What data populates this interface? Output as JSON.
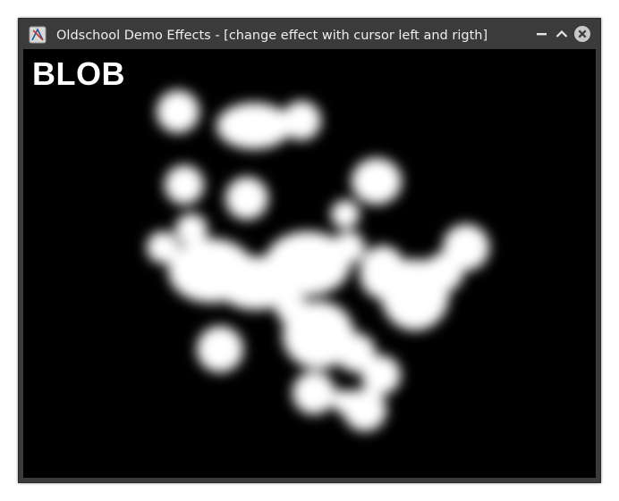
{
  "window": {
    "title": "Oldschool Demo Effects - [change effect with cursor left and rigth]",
    "icon": "app-icon",
    "controls": {
      "minimize_icon": "minimize-icon",
      "maximize_icon": "maximize-icon",
      "close_icon": "close-icon"
    }
  },
  "demo": {
    "effect_name": "BLOB",
    "background_color": "#000000",
    "blob_color": "#ffffff"
  }
}
